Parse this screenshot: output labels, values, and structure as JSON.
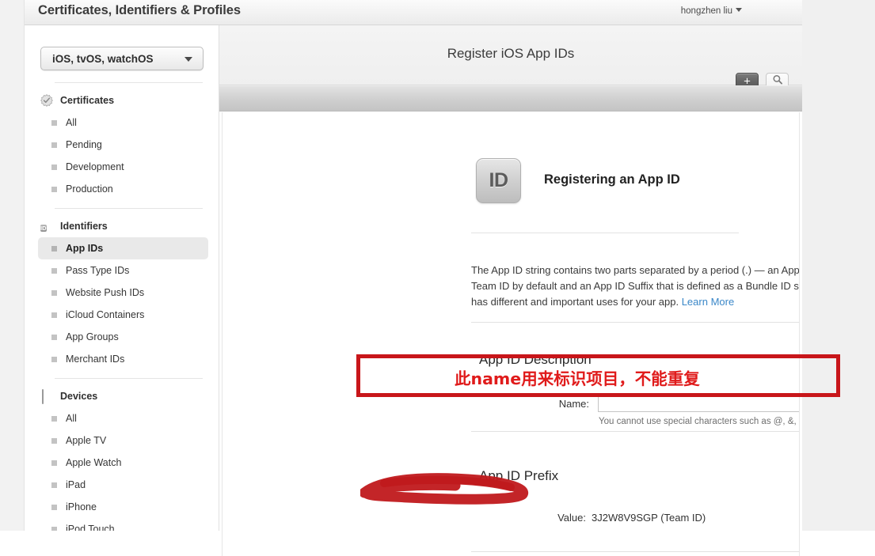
{
  "topbar": {
    "title": "Certificates, Identifiers & Profiles",
    "user": "hongzhen liu",
    "user_caret_icon": "chevron-down-icon"
  },
  "sidebar": {
    "platform_selector": {
      "value": "iOS, tvOS, watchOS",
      "caret_icon": "chevron-down-icon"
    },
    "groups": [
      {
        "title": "Certificates",
        "icon": "certificate-seal-icon",
        "items": [
          "All",
          "Pending",
          "Development",
          "Production"
        ]
      },
      {
        "title": "Identifiers",
        "icon": "id-badge-icon",
        "badge_text": "ID",
        "items": [
          "App IDs",
          "Pass Type IDs",
          "Website Push IDs",
          "iCloud Containers",
          "App Groups",
          "Merchant IDs"
        ],
        "selected": "App IDs"
      },
      {
        "title": "Devices",
        "icon": "device-icon",
        "items": [
          "All",
          "Apple TV",
          "Apple Watch",
          "iPad",
          "iPhone",
          "iPod Touch"
        ]
      }
    ]
  },
  "main": {
    "title": "Register iOS App IDs",
    "add_button": {
      "icon": "plus-icon",
      "label": "+"
    },
    "search_button": {
      "icon": "search-icon"
    },
    "card": {
      "badge_text": "ID",
      "heading": "Registering an App ID",
      "intro": "The App ID string contains two parts separated by a period (.) — an App ID Prefix that is defined as your Team ID by default and an App ID Suffix that is defined as a Bundle ID search string. Each part of an App ID has different and important uses for your app. ",
      "intro_link": "Learn More",
      "sections": [
        {
          "title": "App ID Description",
          "field_label": "Name:",
          "field_value": "",
          "field_placeholder": "",
          "field_help": "You cannot use special characters such as @, &, *, ', \""
        },
        {
          "title": "App ID Prefix",
          "field_label": "Value:",
          "field_value": "3J2W8V9SGP (Team ID)"
        }
      ]
    }
  },
  "annotations": {
    "note_text": "此name用来标识项目，不能重复",
    "note_color": "#e01b1b",
    "box_color": "#c8161a",
    "redaction_color": "#c0191c"
  }
}
